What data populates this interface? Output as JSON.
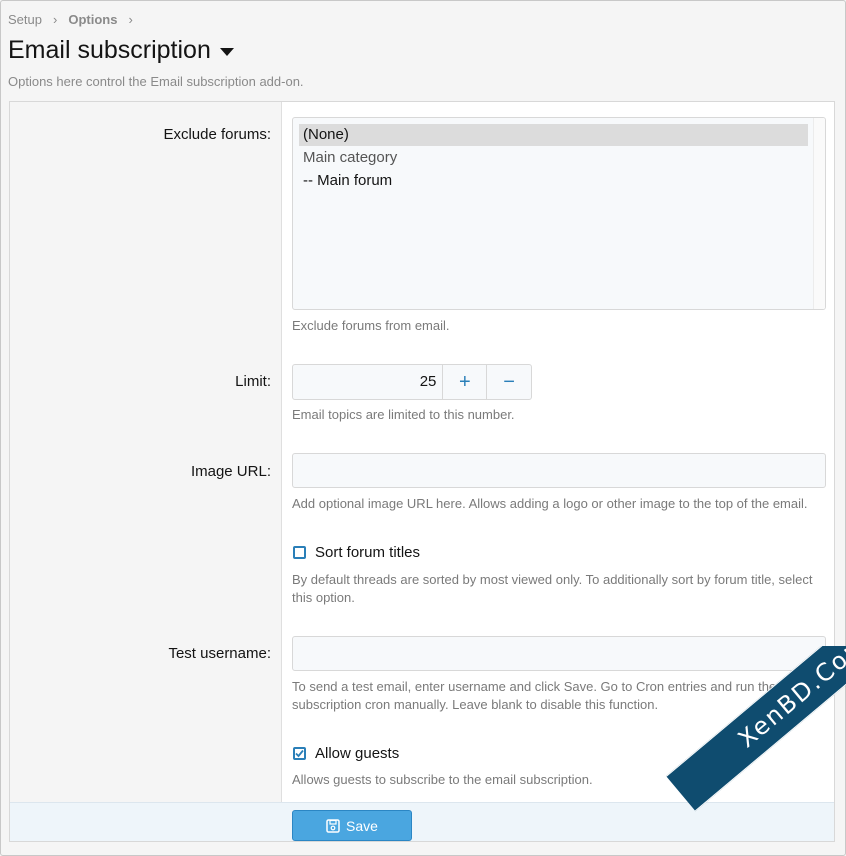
{
  "breadcrumb": {
    "items": [
      "Setup",
      "Options"
    ]
  },
  "page": {
    "title": "Email subscription",
    "description": "Options here control the Email subscription add-on."
  },
  "exclude_forums": {
    "label": "Exclude forums:",
    "options": [
      "(None)",
      "Main category",
      "-- Main forum"
    ],
    "selected_index": 0,
    "help": "Exclude forums from email."
  },
  "limit": {
    "label": "Limit:",
    "value": "25",
    "plus": "+",
    "minus": "−",
    "help": "Email topics are limited to this number."
  },
  "image_url": {
    "label": "Image URL:",
    "value": "",
    "help": "Add optional image URL here. Allows adding a logo or other image to the top of the email."
  },
  "sort_forum_titles": {
    "label": "Sort forum titles",
    "checked": false,
    "help": "By default threads are sorted by most viewed only. To additionally sort by forum title, select this option."
  },
  "test_username": {
    "label": "Test username:",
    "value": "",
    "help": "To send a test email, enter username and click Save. Go to Cron entries and run the Email subscription cron manually. Leave blank to disable this function."
  },
  "allow_guests": {
    "label": "Allow guests",
    "checked": true,
    "help": "Allows guests to subscribe to the email subscription."
  },
  "footer": {
    "save_label": "Save"
  },
  "watermark": {
    "text": "XenBD.Com"
  },
  "colors": {
    "accent": "#2a7fb8",
    "button": "#4aa6e0",
    "watermark": "#0f4c6f"
  }
}
